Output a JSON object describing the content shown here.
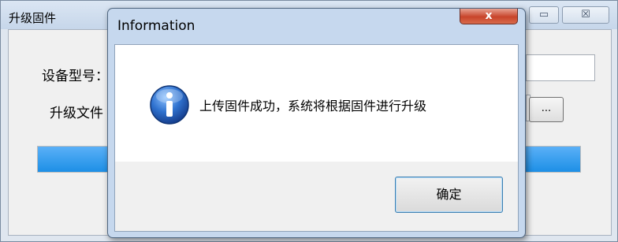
{
  "parent_window": {
    "title": "升级固件",
    "minimize_glyph": "▭",
    "close_glyph": "☒",
    "device_model_label": "设备型号：",
    "upgrade_file_label": "升级文件",
    "browse_label": "...",
    "progress_fraction": 1.0,
    "progress_color": "#1d8fe6"
  },
  "dialog": {
    "title": "Information",
    "close_glyph": "x",
    "icon": "information-icon",
    "message": "上传固件成功，系统将根据固件进行升级",
    "ok_label": "确定"
  },
  "colors": {
    "close_button": "#c8442b",
    "info_icon": "#1f5fb3"
  }
}
